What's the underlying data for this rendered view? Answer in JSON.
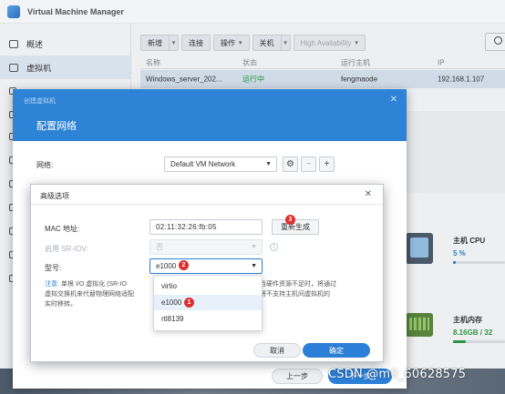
{
  "app": {
    "title": "Virtual Machine Manager"
  },
  "sidebar": {
    "items": [
      {
        "label": "概述",
        "icon": "overview-icon"
      },
      {
        "label": "虚拟机",
        "icon": "vm-icon",
        "active": true
      }
    ]
  },
  "toolbar": {
    "new_label": "新增",
    "connect_label": "连接",
    "action_label": "操作",
    "shutdown_label": "关机",
    "ha_label": "High Availability"
  },
  "grid": {
    "columns": [
      "名称",
      "状态",
      "运行主机",
      "IP"
    ],
    "rows": [
      {
        "name": "Windows_server_202...",
        "status": "运行中",
        "host": "fengmaode",
        "ip": "192.168.1.107"
      }
    ]
  },
  "metrics": {
    "cpu": {
      "title": "主机 CPU",
      "value": "5 %",
      "percent": 5,
      "color": "#2b7fd6"
    },
    "memory": {
      "title": "主机内存",
      "value": "8.16GB / 32",
      "percent": 25,
      "color": "#2f9e44"
    }
  },
  "wizard": {
    "subtitle": "创建虚拟机",
    "title": "配置网络",
    "network_label": "网络:",
    "network_value": "Default VM Network",
    "prev_label": "上一步",
    "next_label": "下一步"
  },
  "advanced": {
    "title": "高级选项",
    "mac_label": "MAC 地址:",
    "mac_value": "02:11:32:26:fb:05",
    "regenerate_label": "重新生成",
    "sriov_label": "启用 SR-IOV:",
    "sriov_value": "否",
    "model_label": "型号:",
    "model_value": "e1000",
    "note_key": "注意:",
    "note_line1_left": "单根 I/O 虚拟化 (SR-IO",
    "note_line1_right": "能。当硬件资源不足时，将通过",
    "note_line2_left": "虚拟交换机来代替物理网络适配",
    "note_line2_right": "后，将不支持主机间虚拟机的",
    "note_line3": "实时移转。",
    "options": [
      "virtio",
      "e1000",
      "rtl8139"
    ],
    "cancel_label": "取消",
    "ok_label": "确定"
  },
  "badges": {
    "regenerate": "3",
    "model": "2",
    "option": "1"
  },
  "watermark": "CSDN @m0_60628575",
  "colors": {
    "accent": "#2b7fd6",
    "header": "#2d83d6",
    "running": "#1f9e3e",
    "badge": "#e02e2e"
  }
}
